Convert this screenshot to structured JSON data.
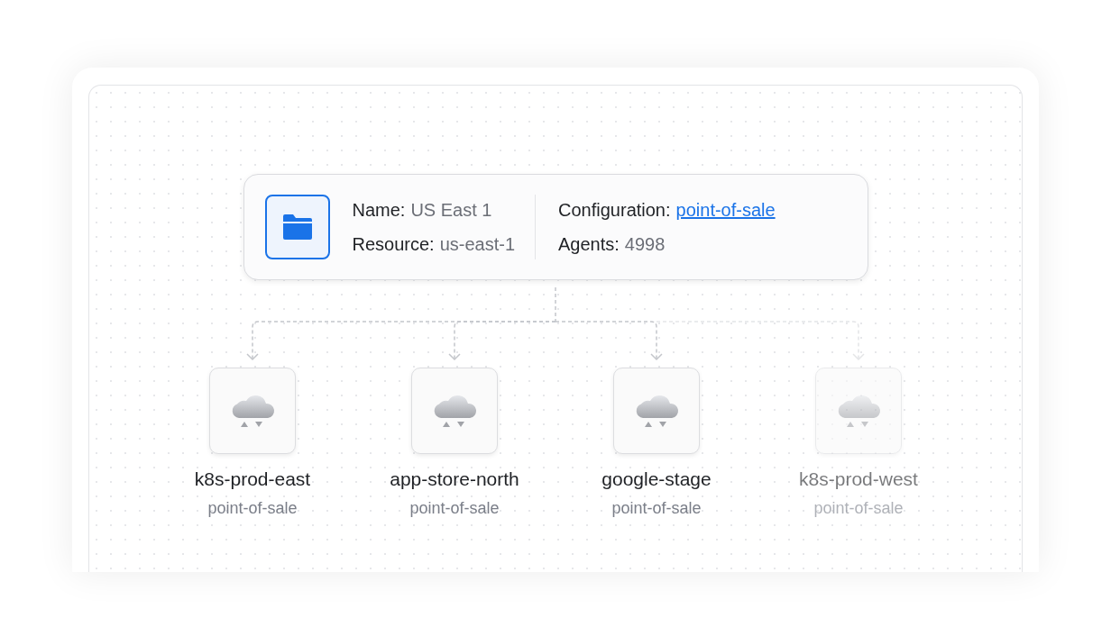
{
  "resource_card": {
    "fields": [
      {
        "label": "Name:",
        "value": "US East 1"
      },
      {
        "label": "Resource:",
        "value": "us-east-1"
      }
    ],
    "details": [
      {
        "label": "Configuration:",
        "value": "point-of-sale",
        "kind": "link"
      },
      {
        "label": "Agents:",
        "value": "4998",
        "kind": "text"
      }
    ]
  },
  "clusters": [
    {
      "name": "k8s-prod-east",
      "configuration": "point-of-sale",
      "disabled": false
    },
    {
      "name": "app-store-north",
      "configuration": "point-of-sale",
      "disabled": false
    },
    {
      "name": "google-stage",
      "configuration": "point-of-sale",
      "disabled": false
    },
    {
      "name": "k8s-prod-west",
      "configuration": "point-of-sale",
      "disabled": true
    }
  ]
}
